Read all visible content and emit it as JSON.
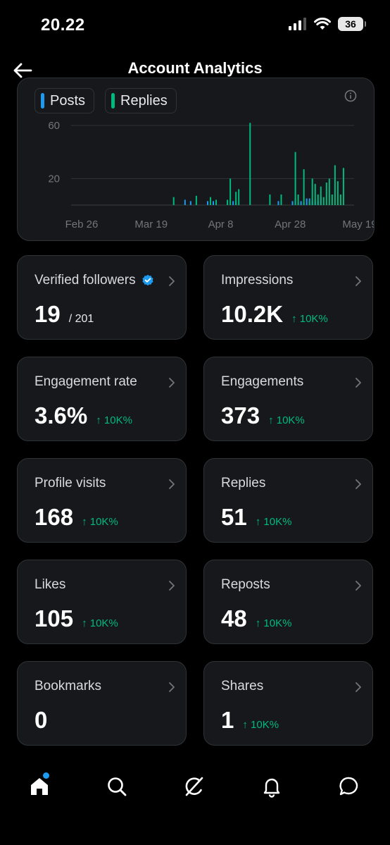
{
  "status": {
    "time": "20.22",
    "battery": "36"
  },
  "header": {
    "title": "Account Analytics"
  },
  "chart": {
    "legend": [
      {
        "label": "Posts",
        "color": "#1d9bf0"
      },
      {
        "label": "Replies",
        "color": "#00ba7c"
      }
    ]
  },
  "chart_data": {
    "type": "bar",
    "x_ticks": [
      "Feb 26",
      "Mar 19",
      "Apr 8",
      "Apr 28",
      "May 19"
    ],
    "y_ticks": [
      60,
      20
    ],
    "ylim": [
      0,
      68
    ],
    "grid": true,
    "series": [
      {
        "name": "Posts",
        "color": "#1d9bf0",
        "values": [
          [
            40,
            4
          ],
          [
            42,
            3
          ],
          [
            48,
            3
          ],
          [
            49,
            5
          ],
          [
            50,
            3
          ],
          [
            57,
            3
          ],
          [
            58,
            3
          ],
          [
            73,
            3
          ],
          [
            78,
            3
          ],
          [
            79,
            5
          ],
          [
            80,
            2
          ],
          [
            81,
            3
          ],
          [
            82,
            2
          ],
          [
            83,
            5
          ],
          [
            84,
            5
          ],
          [
            85,
            3
          ],
          [
            86,
            4
          ],
          [
            87,
            3
          ],
          [
            88,
            6
          ]
        ]
      },
      {
        "name": "Replies",
        "color": "#00ba7c",
        "values": [
          [
            36,
            6
          ],
          [
            44,
            7
          ],
          [
            49,
            6
          ],
          [
            51,
            4
          ],
          [
            55,
            4
          ],
          [
            56,
            20
          ],
          [
            58,
            10
          ],
          [
            59,
            12
          ],
          [
            63,
            62
          ],
          [
            70,
            8
          ],
          [
            74,
            8
          ],
          [
            79,
            40
          ],
          [
            80,
            8
          ],
          [
            82,
            27
          ],
          [
            84,
            3
          ],
          [
            85,
            20
          ],
          [
            86,
            16
          ],
          [
            87,
            8
          ],
          [
            88,
            14
          ],
          [
            89,
            6
          ],
          [
            90,
            17
          ],
          [
            91,
            20
          ],
          [
            92,
            8
          ],
          [
            93,
            30
          ],
          [
            94,
            18
          ],
          [
            95,
            8
          ],
          [
            96,
            28
          ]
        ]
      }
    ]
  },
  "cards": [
    {
      "label": "Verified followers",
      "value": "19",
      "sub": "/ 201",
      "change": "",
      "verified": true
    },
    {
      "label": "Impressions",
      "value": "10.2K",
      "sub": "",
      "change": "↑ 10K%"
    },
    {
      "label": "Engagement rate",
      "value": "3.6%",
      "sub": "",
      "change": "↑ 10K%"
    },
    {
      "label": "Engagements",
      "value": "373",
      "sub": "",
      "change": "↑ 10K%"
    },
    {
      "label": "Profile visits",
      "value": "168",
      "sub": "",
      "change": "↑ 10K%"
    },
    {
      "label": "Replies",
      "value": "51",
      "sub": "",
      "change": "↑ 10K%"
    },
    {
      "label": "Likes",
      "value": "105",
      "sub": "",
      "change": "↑ 10K%"
    },
    {
      "label": "Reposts",
      "value": "48",
      "sub": "",
      "change": "↑ 10K%"
    },
    {
      "label": "Bookmarks",
      "value": "0",
      "sub": "",
      "change": ""
    },
    {
      "label": "Shares",
      "value": "1",
      "sub": "",
      "change": "↑ 10K%"
    }
  ],
  "tabbar": {
    "icons": [
      "home-icon",
      "search-icon",
      "grok-icon",
      "bell-icon",
      "messages-icon"
    ]
  }
}
